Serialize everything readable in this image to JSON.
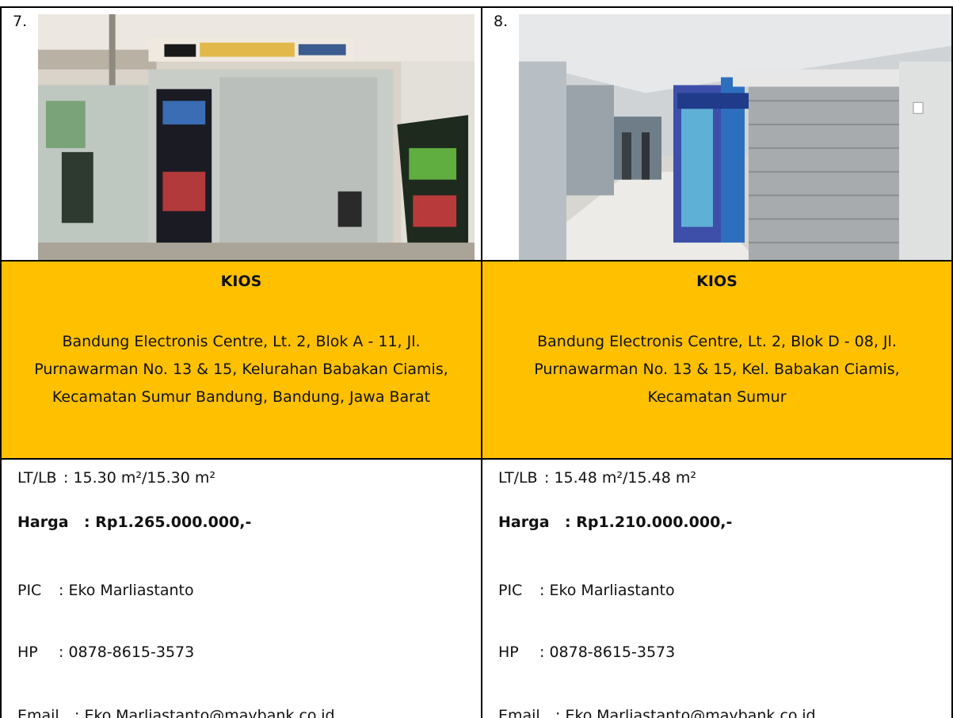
{
  "listings": [
    {
      "number": "7.",
      "type": "KIOS",
      "address": "Bandung Electronis Centre, Lt. 2, Blok A - 11, Jl. Purnawarman No. 13 & 15, Kelurahan Babakan Ciamis, Kecamatan Sumur Bandung, Bandung, Jawa Barat",
      "area_label": "LT/LB",
      "area_value": ": 15.30 m²/15.30 m²",
      "price_label": "Harga",
      "price_value": ": Rp1.265.000.000,-",
      "pic_label": "PIC",
      "pic_value": ": Eko Marliastanto",
      "phone_label": "HP",
      "phone_value": ": 0878-8615-3573",
      "email_label": "Email",
      "email_value": ": Eko.Marliastanto@maybank.co.id"
    },
    {
      "number": "8.",
      "type": "KIOS",
      "address": "Bandung Electronis Centre, Lt. 2, Blok D - 08, Jl. Purnawarman No. 13 & 15, Kel. Babakan Ciamis, Kecamatan Sumur",
      "area_label": "LT/LB",
      "area_value": ": 15.48 m²/15.48 m²",
      "price_label": "Harga",
      "price_value": ": Rp1.210.000.000,-",
      "pic_label": "PIC",
      "pic_value": ": Eko Marliastanto",
      "phone_label": "HP",
      "phone_value": ": 0878-8615-3573",
      "email_label": "Email",
      "email_value": ": Eko.Marliastanto@maybank.co.id"
    }
  ],
  "colors": {
    "highlight": "#ffc000",
    "border": "#000000"
  }
}
